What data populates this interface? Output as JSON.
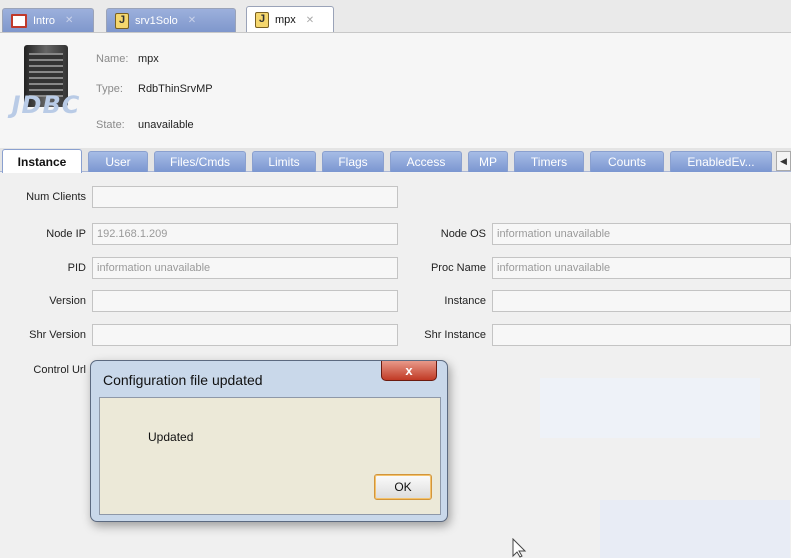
{
  "doc_tabs": [
    {
      "label": "Intro",
      "active": false
    },
    {
      "label": "srv1Solo",
      "active": false
    },
    {
      "label": "mpx",
      "active": true
    }
  ],
  "header": {
    "icon_label": "JDBC",
    "name_key": "Name:",
    "name_value": "mpx",
    "type_key": "Type:",
    "type_value": "RdbThinSrvMP",
    "state_key": "State:",
    "state_value": "unavailable"
  },
  "section_tabs": [
    {
      "label": "Instance",
      "active": true
    },
    {
      "label": "User",
      "active": false
    },
    {
      "label": "Files/Cmds",
      "active": false
    },
    {
      "label": "Limits",
      "active": false
    },
    {
      "label": "Flags",
      "active": false
    },
    {
      "label": "Access",
      "active": false
    },
    {
      "label": "MP",
      "active": false
    },
    {
      "label": "Timers",
      "active": false
    },
    {
      "label": "Counts",
      "active": false
    },
    {
      "label": "EnabledEv...",
      "active": false
    }
  ],
  "form": {
    "num_clients": {
      "label": "Num Clients",
      "value": ""
    },
    "node_ip": {
      "label": "Node IP",
      "value": "192.168.1.209"
    },
    "node_os": {
      "label": "Node OS",
      "value": "information unavailable"
    },
    "pid": {
      "label": "PID",
      "value": "information unavailable"
    },
    "proc_name": {
      "label": "Proc Name",
      "value": "information unavailable"
    },
    "version": {
      "label": "Version",
      "value": ""
    },
    "instance": {
      "label": "Instance",
      "value": ""
    },
    "shr_version": {
      "label": "Shr Version",
      "value": ""
    },
    "shr_instance": {
      "label": "Shr Instance",
      "value": ""
    },
    "control_url": {
      "label": "Control Url"
    }
  },
  "dialog": {
    "title": "Configuration file updated",
    "close_label": "x",
    "message": "Updated",
    "ok_label": "OK"
  },
  "colors": {
    "tab_inactive": "#7f97cc",
    "dialog_frame": "#c9d8ea",
    "dialog_close": "#c13a25",
    "dialog_body": "#ece9d8"
  }
}
